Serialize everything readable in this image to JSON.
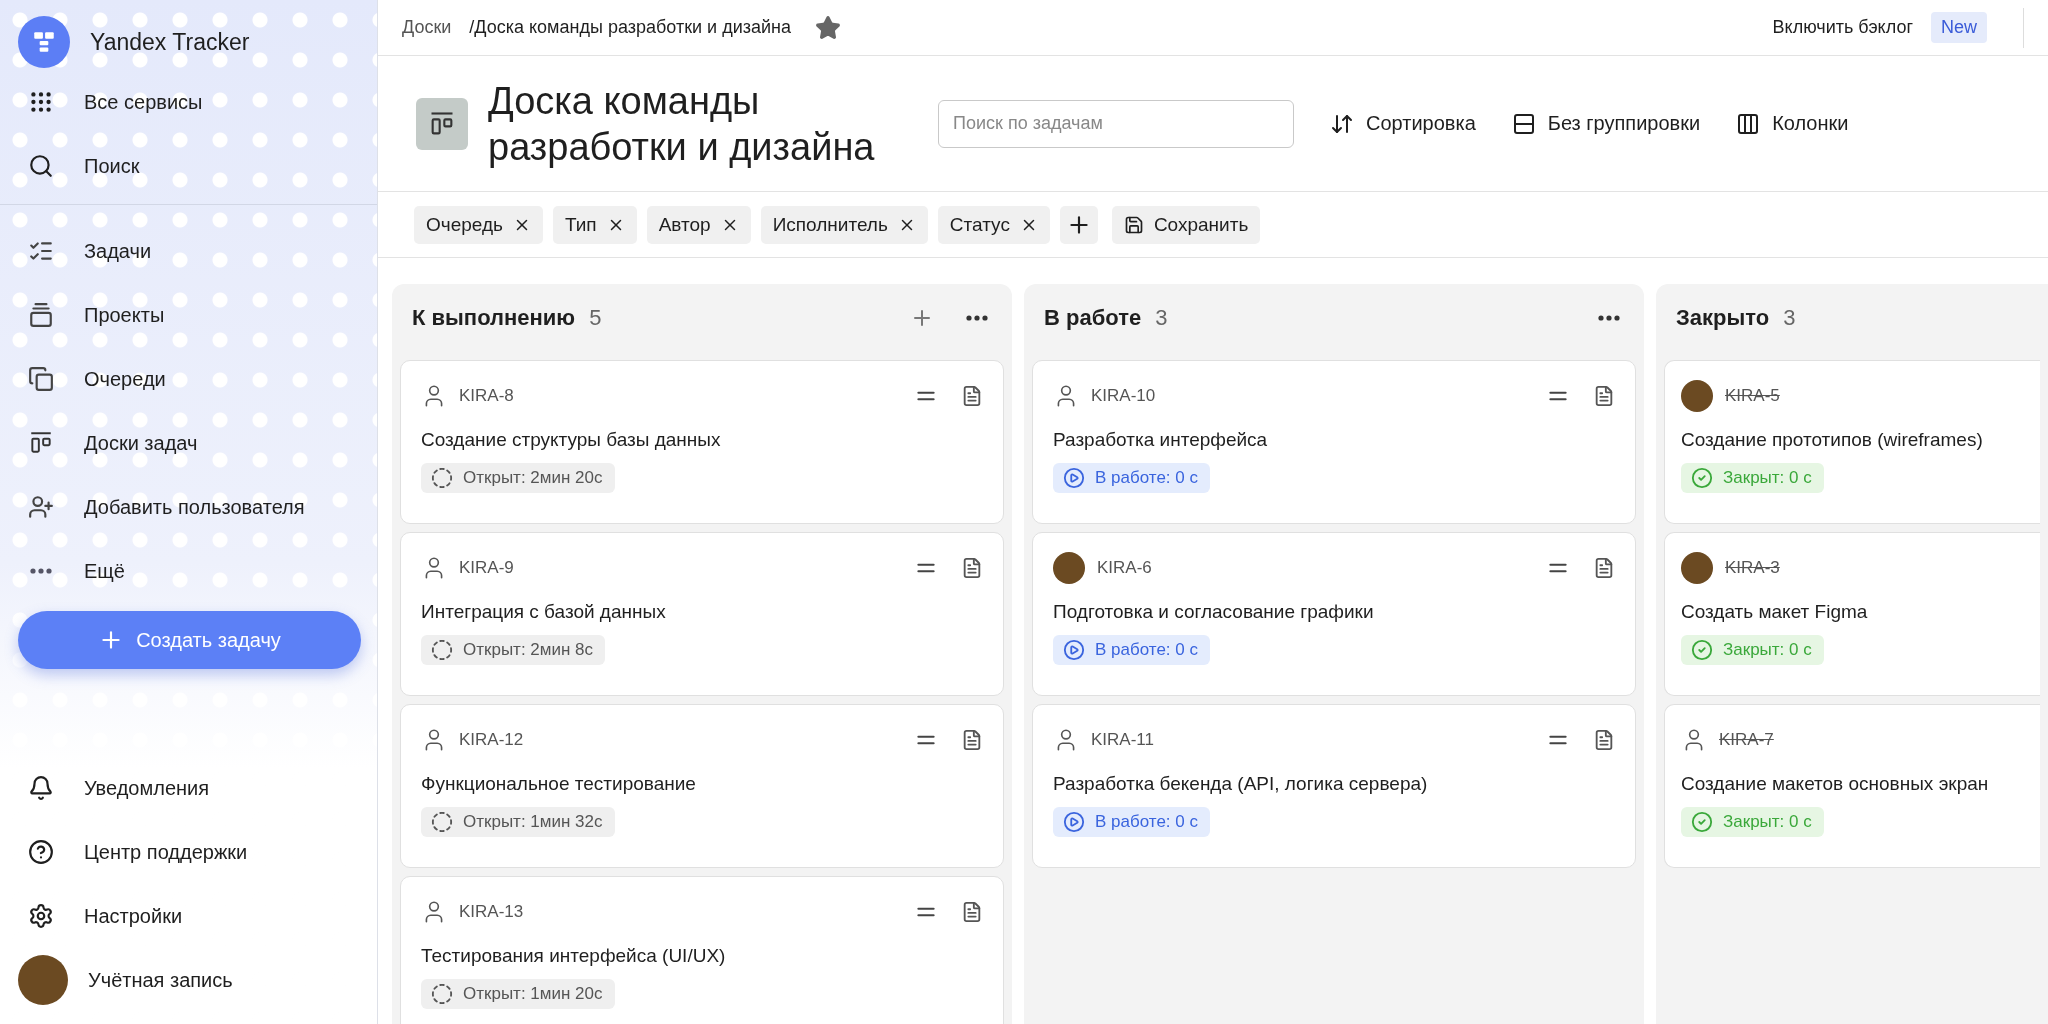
{
  "sidebar": {
    "brand": "Yandex Tracker",
    "top_items": [
      {
        "label": "Все сервисы"
      },
      {
        "label": "Поиск"
      }
    ],
    "nav_items": [
      {
        "label": "Задачи"
      },
      {
        "label": "Проекты"
      },
      {
        "label": "Очереди"
      },
      {
        "label": "Доски задач"
      },
      {
        "label": "Добавить пользователя"
      },
      {
        "label": "Ещё"
      }
    ],
    "create_button": "Создать задачу",
    "bottom_items": [
      {
        "label": "Уведомления"
      },
      {
        "label": "Центр поддержки"
      },
      {
        "label": "Настройки"
      },
      {
        "label": "Учётная запись"
      }
    ]
  },
  "breadcrumbs": [
    "Доски",
    "/Доска команды разработки и дизайна"
  ],
  "backlog": {
    "label": "Включить бэклог",
    "badge": "New"
  },
  "board": {
    "title": "Доска команды разработки и дизайна",
    "search": {
      "placeholder": "Поиск по задачам"
    },
    "actions": [
      "Сортировка",
      "Без группировки",
      "Колонки"
    ],
    "filters": [
      "Очередь",
      "Тип",
      "Автор",
      "Исполнитель",
      "Статус"
    ],
    "save_button": "Сохранить"
  },
  "columns": [
    {
      "title": "К выполнению",
      "count": "5",
      "can_add": true,
      "has_menu": true,
      "cards": [
        {
          "key": "KIRA-8",
          "title": "Создание структуры базы данных",
          "kind": "open",
          "badge": "Открыт: 2мин 20с",
          "assignee": false,
          "has_actions": true
        },
        {
          "key": "KIRA-9",
          "title": "Интеграция с базой данных",
          "kind": "open",
          "badge": "Открыт: 2мин 8с",
          "assignee": false,
          "has_actions": true
        },
        {
          "key": "KIRA-12",
          "title": "Функциональное тестирование",
          "kind": "open",
          "badge": "Открыт: 1мин 32с",
          "assignee": false,
          "has_actions": true
        },
        {
          "key": "KIRA-13",
          "title": "Тестирования интерфейса (UI/UX)",
          "kind": "open",
          "badge": "Открыт: 1мин 20с",
          "assignee": false,
          "has_actions": true
        }
      ]
    },
    {
      "title": "В работе",
      "count": "3",
      "can_add": false,
      "has_menu": true,
      "cards": [
        {
          "key": "KIRA-10",
          "title": "Разработка интерфейса",
          "kind": "in_progress",
          "badge": "В работе: 0 с",
          "assignee": false,
          "has_actions": true
        },
        {
          "key": "KIRA-6",
          "title": "Подготовка и согласование графики",
          "kind": "in_progress",
          "badge": "В работе: 0 с",
          "assignee": true,
          "has_actions": true
        },
        {
          "key": "KIRA-11",
          "title": "Разработка бекенда (API, логика сервера)",
          "kind": "in_progress",
          "badge": "В работе: 0 с",
          "assignee": false,
          "has_actions": true
        }
      ]
    },
    {
      "title": "Закрыто",
      "count": "3",
      "can_add": false,
      "has_menu": false,
      "cards": [
        {
          "key": "KIRA-5",
          "title": "Создание прототипов (wireframes)",
          "kind": "closed",
          "badge": "Закрыт: 0 с",
          "assignee": true,
          "has_actions": false
        },
        {
          "key": "KIRA-3",
          "title": "Создать макет Figma",
          "kind": "closed",
          "badge": "Закрыт: 0 с",
          "assignee": true,
          "has_actions": false
        },
        {
          "key": "KIRA-7",
          "title": "Создание макетов основных экран",
          "kind": "closed",
          "badge": "Закрыт: 0 с",
          "assignee": false,
          "has_actions": false
        }
      ]
    }
  ]
}
